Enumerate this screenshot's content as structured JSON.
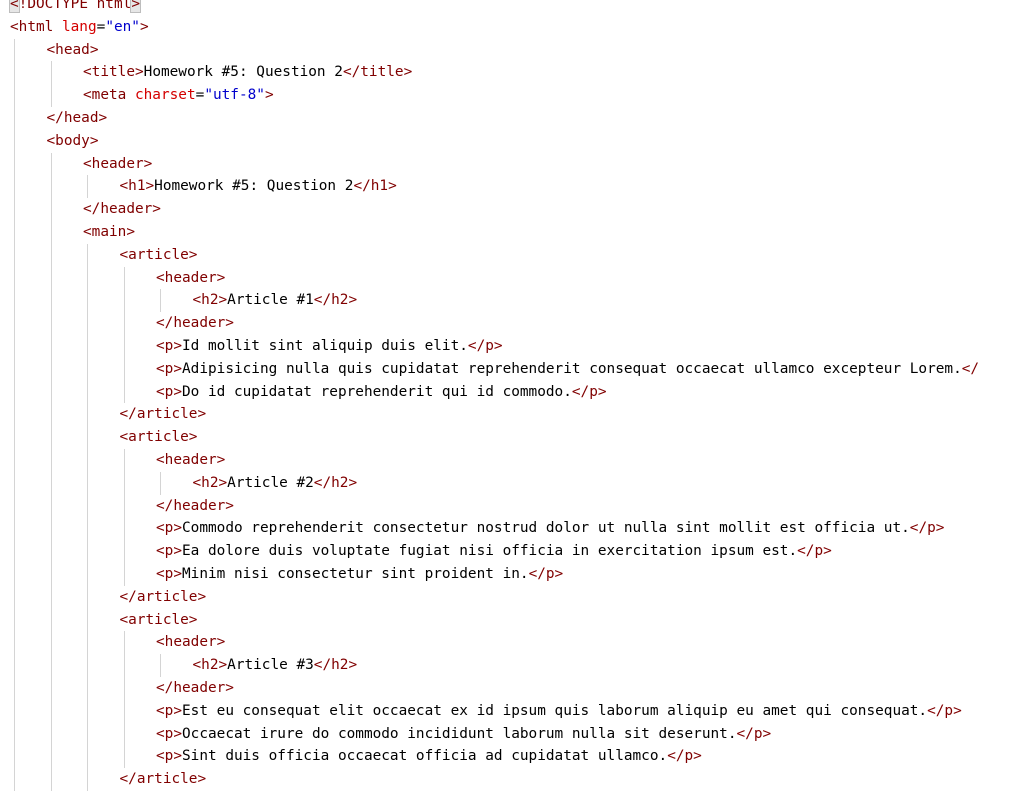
{
  "code": {
    "lines": [
      {
        "indent": 0,
        "tokens": [
          {
            "t": "<",
            "c": "tag hl"
          },
          {
            "t": "!DOCTYPE html",
            "c": "tag"
          },
          {
            "t": ">",
            "c": "tag hl"
          }
        ]
      },
      {
        "indent": 0,
        "tokens": [
          {
            "t": "<html ",
            "c": "tag"
          },
          {
            "t": "lang",
            "c": "attr"
          },
          {
            "t": "=",
            "c": "txt"
          },
          {
            "t": "\"en\"",
            "c": "val"
          },
          {
            "t": ">",
            "c": "tag"
          }
        ]
      },
      {
        "indent": 1,
        "tokens": [
          {
            "t": "<head>",
            "c": "tag"
          }
        ]
      },
      {
        "indent": 2,
        "tokens": [
          {
            "t": "<title>",
            "c": "tag"
          },
          {
            "t": "Homework #5: Question 2",
            "c": "txt"
          },
          {
            "t": "</title>",
            "c": "tag"
          }
        ]
      },
      {
        "indent": 2,
        "tokens": [
          {
            "t": "<meta ",
            "c": "tag"
          },
          {
            "t": "charset",
            "c": "attr"
          },
          {
            "t": "=",
            "c": "txt"
          },
          {
            "t": "\"utf-8\"",
            "c": "val"
          },
          {
            "t": ">",
            "c": "tag"
          }
        ]
      },
      {
        "indent": 1,
        "tokens": [
          {
            "t": "</head>",
            "c": "tag"
          }
        ]
      },
      {
        "indent": 1,
        "tokens": [
          {
            "t": "<body>",
            "c": "tag"
          }
        ]
      },
      {
        "indent": 2,
        "tokens": [
          {
            "t": "<header>",
            "c": "tag"
          }
        ]
      },
      {
        "indent": 3,
        "tokens": [
          {
            "t": "<h1>",
            "c": "tag"
          },
          {
            "t": "Homework #5: Question 2",
            "c": "txt"
          },
          {
            "t": "</h1>",
            "c": "tag"
          }
        ]
      },
      {
        "indent": 2,
        "tokens": [
          {
            "t": "</header>",
            "c": "tag"
          }
        ]
      },
      {
        "indent": 2,
        "tokens": [
          {
            "t": "<main>",
            "c": "tag"
          }
        ]
      },
      {
        "indent": 3,
        "tokens": [
          {
            "t": "<article>",
            "c": "tag"
          }
        ]
      },
      {
        "indent": 4,
        "tokens": [
          {
            "t": "<header>",
            "c": "tag"
          }
        ]
      },
      {
        "indent": 5,
        "tokens": [
          {
            "t": "<h2>",
            "c": "tag"
          },
          {
            "t": "Article #1",
            "c": "txt"
          },
          {
            "t": "</h2>",
            "c": "tag"
          }
        ]
      },
      {
        "indent": 4,
        "tokens": [
          {
            "t": "</header>",
            "c": "tag"
          }
        ]
      },
      {
        "indent": 4,
        "tokens": [
          {
            "t": "<p>",
            "c": "tag"
          },
          {
            "t": "Id mollit sint aliquip duis elit.",
            "c": "txt"
          },
          {
            "t": "</p>",
            "c": "tag"
          }
        ]
      },
      {
        "indent": 4,
        "tokens": [
          {
            "t": "<p>",
            "c": "tag"
          },
          {
            "t": "Adipisicing nulla quis cupidatat reprehenderit consequat occaecat ullamco excepteur Lorem.",
            "c": "txt"
          },
          {
            "t": "</",
            "c": "tag"
          }
        ]
      },
      {
        "indent": 4,
        "tokens": [
          {
            "t": "<p>",
            "c": "tag"
          },
          {
            "t": "Do id cupidatat reprehenderit qui id commodo.",
            "c": "txt"
          },
          {
            "t": "</p>",
            "c": "tag"
          }
        ]
      },
      {
        "indent": 3,
        "tokens": [
          {
            "t": "</article>",
            "c": "tag"
          }
        ]
      },
      {
        "indent": 3,
        "tokens": [
          {
            "t": "<article>",
            "c": "tag"
          }
        ]
      },
      {
        "indent": 4,
        "tokens": [
          {
            "t": "<header>",
            "c": "tag"
          }
        ]
      },
      {
        "indent": 5,
        "tokens": [
          {
            "t": "<h2>",
            "c": "tag"
          },
          {
            "t": "Article #2",
            "c": "txt"
          },
          {
            "t": "</h2>",
            "c": "tag"
          }
        ]
      },
      {
        "indent": 4,
        "tokens": [
          {
            "t": "</header>",
            "c": "tag"
          }
        ]
      },
      {
        "indent": 4,
        "tokens": [
          {
            "t": "<p>",
            "c": "tag"
          },
          {
            "t": "Commodo reprehenderit consectetur nostrud dolor ut nulla sint mollit est officia ut.",
            "c": "txt"
          },
          {
            "t": "</p>",
            "c": "tag"
          }
        ]
      },
      {
        "indent": 4,
        "tokens": [
          {
            "t": "<p>",
            "c": "tag"
          },
          {
            "t": "Ea dolore duis voluptate fugiat nisi officia in exercitation ipsum est.",
            "c": "txt"
          },
          {
            "t": "</p>",
            "c": "tag"
          }
        ]
      },
      {
        "indent": 4,
        "tokens": [
          {
            "t": "<p>",
            "c": "tag"
          },
          {
            "t": "Minim nisi consectetur sint proident in.",
            "c": "txt"
          },
          {
            "t": "</p>",
            "c": "tag"
          }
        ]
      },
      {
        "indent": 3,
        "tokens": [
          {
            "t": "</article>",
            "c": "tag"
          }
        ]
      },
      {
        "indent": 3,
        "tokens": [
          {
            "t": "<article>",
            "c": "tag"
          }
        ]
      },
      {
        "indent": 4,
        "tokens": [
          {
            "t": "<header>",
            "c": "tag"
          }
        ]
      },
      {
        "indent": 5,
        "tokens": [
          {
            "t": "<h2>",
            "c": "tag"
          },
          {
            "t": "Article #3",
            "c": "txt"
          },
          {
            "t": "</h2>",
            "c": "tag"
          }
        ]
      },
      {
        "indent": 4,
        "tokens": [
          {
            "t": "</header>",
            "c": "tag"
          }
        ]
      },
      {
        "indent": 4,
        "tokens": [
          {
            "t": "<p>",
            "c": "tag"
          },
          {
            "t": "Est eu consequat elit occaecat ex id ipsum quis laborum aliquip eu amet qui consequat.",
            "c": "txt"
          },
          {
            "t": "</p>",
            "c": "tag"
          }
        ]
      },
      {
        "indent": 4,
        "tokens": [
          {
            "t": "<p>",
            "c": "tag"
          },
          {
            "t": "Occaecat irure do commodo incididunt laborum nulla sit deserunt.",
            "c": "txt"
          },
          {
            "t": "</p>",
            "c": "tag"
          }
        ]
      },
      {
        "indent": 4,
        "tokens": [
          {
            "t": "<p>",
            "c": "tag"
          },
          {
            "t": "Sint duis officia occaecat officia ad cupidatat ullamco.",
            "c": "txt"
          },
          {
            "t": "</p>",
            "c": "tag"
          }
        ]
      },
      {
        "indent": 3,
        "tokens": [
          {
            "t": "</article>",
            "c": "tag"
          }
        ]
      }
    ]
  },
  "colors": {
    "tag": "#800000",
    "attribute": "#d40000",
    "value": "#0000cc",
    "text": "#000000",
    "indent_guide": "#d4d4d4",
    "background": "#ffffff"
  }
}
